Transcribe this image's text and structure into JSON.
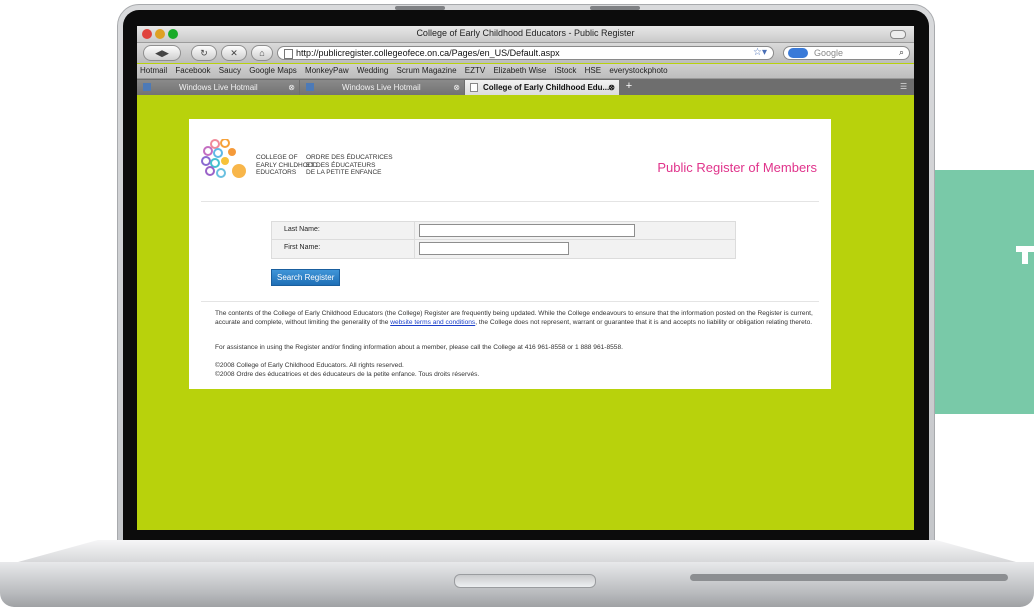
{
  "browser": {
    "window_title": "College of Early Childhood Educators - Public Register",
    "url": "http://publicregister.collegeofece.on.ca/Pages/en_US/Default.aspx",
    "search_placeholder": "Google",
    "bookmarks": [
      "Hotmail",
      "Facebook",
      "Saucy",
      "Google Maps",
      "MonkeyPaw",
      "Wedding",
      "Scrum Magazine",
      "EZTV",
      "Elizabeth Wise",
      "iStock",
      "HSE",
      "everystockphoto"
    ],
    "tabs": [
      {
        "label": "Windows Live Hotmail"
      },
      {
        "label": "Windows Live Hotmail"
      },
      {
        "label": "College of Early Childhood Edu..."
      }
    ],
    "new_tab_label": "+"
  },
  "page": {
    "logo_en": [
      "COLLEGE OF",
      "EARLY CHILDHOOD",
      "EDUCATORS"
    ],
    "logo_fr": [
      "ORDRE DES ÉDUCATRICES",
      "ET DES ÉDUCATEURS",
      "DE LA PETITE ENFANCE"
    ],
    "title": "Public Register of Members",
    "form": {
      "last_name_label": "Last Name:",
      "first_name_label": "First Name:",
      "last_name_value": "",
      "first_name_value": "",
      "submit_label": "Search Register"
    },
    "disclaimer_before_link": "The contents of the College of Early Childhood Educators (the College) Register are frequently being updated. While the College endeavours to ensure that the information posted on the Register is current, accurate and complete, without limiting the generality of the ",
    "disclaimer_link": "website terms and conditions",
    "disclaimer_after_link": ", the College does not represent, warrant or guarantee that it is and accepts no liability or obligation relating thereto.",
    "assistance": "For assistance in using the Register and/or finding information about a member, please call the College at 416 961-8558 or 1 888 961-8558.",
    "copyright_en": "©2008 College of Early Childhood Educators. All rights reserved.",
    "copyright_fr": "©2008 Ordre des éducatrices et des éducateurs de la petite enfance. Tous droits réservés."
  },
  "colors": {
    "page_background": "#b8d20c",
    "title_pink": "#e0338b",
    "button_blue": "#2a7dc4",
    "teal_panel": "#79c9a8"
  }
}
